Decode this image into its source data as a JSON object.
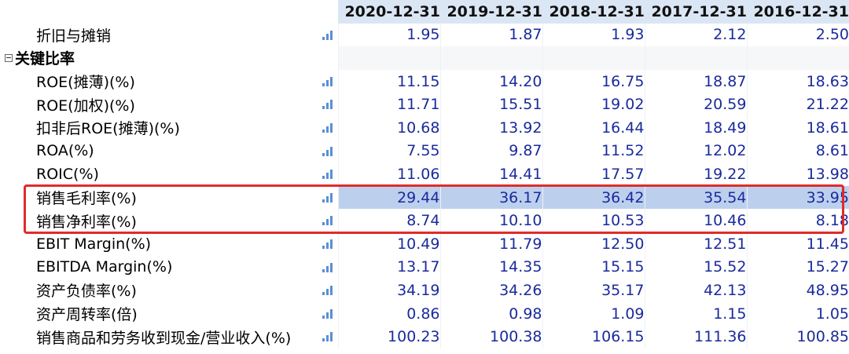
{
  "columns": [
    "2020-12-31",
    "2019-12-31",
    "2018-12-31",
    "2017-12-31",
    "2016-12-31"
  ],
  "rows": [
    {
      "label": "折旧与摊销",
      "values": [
        "1.95",
        "1.87",
        "1.93",
        "2.12",
        "2.50"
      ]
    },
    {
      "label": "关键比率",
      "section": true
    },
    {
      "label": "ROE(摊薄)(%)",
      "values": [
        "11.15",
        "14.20",
        "16.75",
        "18.87",
        "18.63"
      ]
    },
    {
      "label": "ROE(加权)(%)",
      "values": [
        "11.71",
        "15.51",
        "19.02",
        "20.59",
        "21.22"
      ]
    },
    {
      "label": "扣非后ROE(摊薄)(%)",
      "values": [
        "10.68",
        "13.92",
        "16.44",
        "18.49",
        "18.61"
      ]
    },
    {
      "label": "ROA(%)",
      "values": [
        "7.55",
        "9.87",
        "11.52",
        "12.02",
        "8.61"
      ]
    },
    {
      "label": "ROIC(%)",
      "values": [
        "11.06",
        "14.41",
        "17.57",
        "19.22",
        "13.98"
      ]
    },
    {
      "label": "销售毛利率(%)",
      "values": [
        "29.44",
        "36.17",
        "36.42",
        "35.54",
        "33.95"
      ],
      "selected": true
    },
    {
      "label": "销售净利率(%)",
      "values": [
        "8.74",
        "10.10",
        "10.53",
        "10.46",
        "8.18"
      ]
    },
    {
      "label": "EBIT Margin(%)",
      "values": [
        "10.49",
        "11.79",
        "12.50",
        "12.51",
        "11.45"
      ]
    },
    {
      "label": "EBITDA Margin(%)",
      "values": [
        "13.17",
        "14.35",
        "15.15",
        "15.52",
        "15.27"
      ]
    },
    {
      "label": "资产负债率(%)",
      "values": [
        "34.19",
        "34.26",
        "35.17",
        "42.13",
        "48.95"
      ]
    },
    {
      "label": "资产周转率(倍)",
      "values": [
        "0.86",
        "0.98",
        "1.09",
        "1.15",
        "1.05"
      ]
    },
    {
      "label": "销售商品和劳务收到现金/营业收入(%)",
      "values": [
        "100.23",
        "100.38",
        "106.15",
        "111.36",
        "100.85"
      ]
    }
  ],
  "colors": {
    "value_text": "#1a2a9c",
    "header_bg": "#dbe6f5",
    "selected_bg": "#bcd0ee",
    "highlight_border": "#e02b2b",
    "chart_icon": "#5a8fd6"
  },
  "icons": {
    "row_chart": "bar-chart-icon",
    "section_toggle": "collapse-minus-icon"
  }
}
